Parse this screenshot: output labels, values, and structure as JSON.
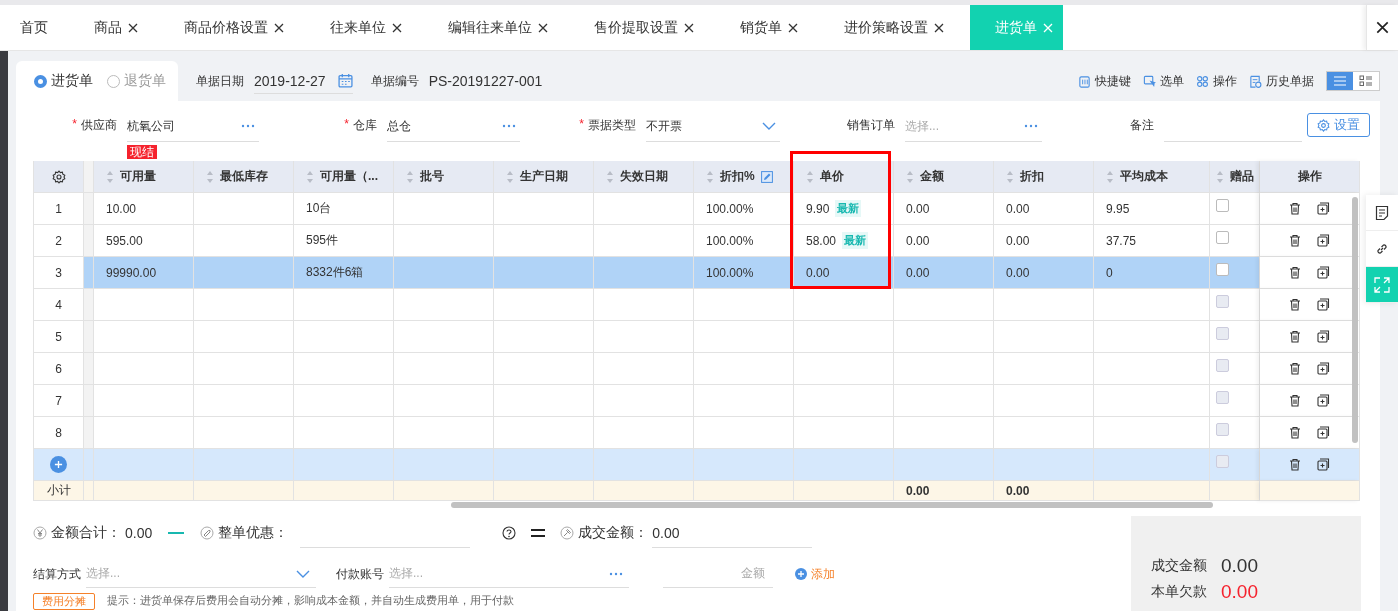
{
  "tabs": [
    {
      "label": "首页",
      "closable": false,
      "selected": false
    },
    {
      "label": "商品",
      "closable": true,
      "selected": false
    },
    {
      "label": "商品价格设置",
      "closable": true,
      "selected": false
    },
    {
      "label": "往来单位",
      "closable": true,
      "selected": false
    },
    {
      "label": "编辑往来单位",
      "closable": true,
      "selected": false
    },
    {
      "label": "售价提取设置",
      "closable": true,
      "selected": false
    },
    {
      "label": "销货单",
      "closable": true,
      "selected": false
    },
    {
      "label": "进价策略设置",
      "closable": true,
      "selected": false
    },
    {
      "label": "进货单",
      "closable": true,
      "selected": true
    }
  ],
  "doc_types": [
    {
      "label": "进货单",
      "selected": true
    },
    {
      "label": "退货单",
      "selected": false
    }
  ],
  "header_fields": [
    {
      "label": "单据日期",
      "value": "2019-12-27",
      "kind": "date"
    },
    {
      "label": "单据编号",
      "value": "PS-20191227-001",
      "kind": "text"
    }
  ],
  "toolbar": [
    {
      "label": "快捷键"
    },
    {
      "label": "选单"
    },
    {
      "label": "操作"
    },
    {
      "label": "历史单据"
    }
  ],
  "view_modes": [
    {
      "selected": true
    },
    {
      "selected": false
    }
  ],
  "form": [
    {
      "label": "供应商",
      "required_mark": "*",
      "value": "杭氧公司",
      "kind": "lookup",
      "badge": "现结"
    },
    {
      "label": "仓库",
      "required_mark": "*",
      "value": "总仓",
      "kind": "lookup"
    },
    {
      "label": "票据类型",
      "required_mark": "*",
      "value": "不开票",
      "kind": "select"
    },
    {
      "label": "销售订单",
      "placeholder": "选择...",
      "kind": "lookup"
    },
    {
      "label": "备注",
      "kind": "text"
    }
  ],
  "settings_button": "设置",
  "table": {
    "columns": [
      {
        "label": "可用量"
      },
      {
        "label": "最低库存"
      },
      {
        "label": "可用量（..."
      },
      {
        "label": "批号"
      },
      {
        "label": "生产日期"
      },
      {
        "label": "失效日期"
      },
      {
        "label": "折扣%",
        "edit_icon": true
      },
      {
        "label": "单价"
      },
      {
        "label": "金额"
      },
      {
        "label": "折扣"
      },
      {
        "label": "平均成本"
      },
      {
        "label": "赠品"
      }
    ],
    "actions_label": "操作",
    "rows": [
      {
        "index": "1",
        "selected": false,
        "available": "10.00",
        "available_units": "10台",
        "discount_pct": "100.00%",
        "unit_price": "9.90",
        "price_tag": "最新",
        "amount": "0.00",
        "discount": "0.00",
        "avg_cost": "9.95",
        "gift": {
          "checked": false,
          "disabled": false
        }
      },
      {
        "index": "2",
        "selected": false,
        "available": "595.00",
        "available_units": "595件",
        "discount_pct": "100.00%",
        "unit_price": "58.00",
        "price_tag": "最新",
        "amount": "0.00",
        "discount": "0.00",
        "avg_cost": "37.75",
        "gift": {
          "checked": false,
          "disabled": false
        }
      },
      {
        "index": "3",
        "selected": true,
        "available": "99990.00",
        "available_units": "8332件6箱",
        "discount_pct": "100.00%",
        "unit_price": "0.00",
        "amount": "0.00",
        "discount": "0.00",
        "avg_cost": "0",
        "gift": {
          "checked": false,
          "disabled": false
        }
      },
      {
        "index": "4",
        "selected": false,
        "gift": {
          "checked": false,
          "disabled": true
        }
      },
      {
        "index": "5",
        "selected": false,
        "gift": {
          "checked": false,
          "disabled": true
        }
      },
      {
        "index": "6",
        "selected": false,
        "gift": {
          "checked": false,
          "disabled": true
        }
      },
      {
        "index": "7",
        "selected": false,
        "gift": {
          "checked": false,
          "disabled": true
        }
      },
      {
        "index": "8",
        "selected": false,
        "gift": {
          "checked": false,
          "disabled": true
        }
      }
    ],
    "add_row": {
      "gift": {
        "checked": false,
        "disabled": true
      }
    },
    "subtotal": {
      "label": "小计",
      "amount": "0.00",
      "discount": "0.00"
    }
  },
  "summary": {
    "total_label": "金额合计：",
    "total": "0.00",
    "discount_label": "整单优惠：",
    "deal_label": "成交金额：",
    "deal": "0.00"
  },
  "totals_box": [
    {
      "label": "成交金额",
      "value": "0.00",
      "kind": "normal"
    },
    {
      "label": "本单欠款",
      "value": "0.00",
      "kind": "due"
    }
  ],
  "payment": {
    "method_label": "结算方式",
    "method_placeholder": "选择...",
    "account_label": "付款账号",
    "account_placeholder": "选择...",
    "amount_placeholder": "金额",
    "add_label": "添加"
  },
  "footer": {
    "button": "费用分摊",
    "hint": "提示：进货单保存后费用会自动分摊，影响成本金额，并自动生成费用单，用于付款"
  }
}
